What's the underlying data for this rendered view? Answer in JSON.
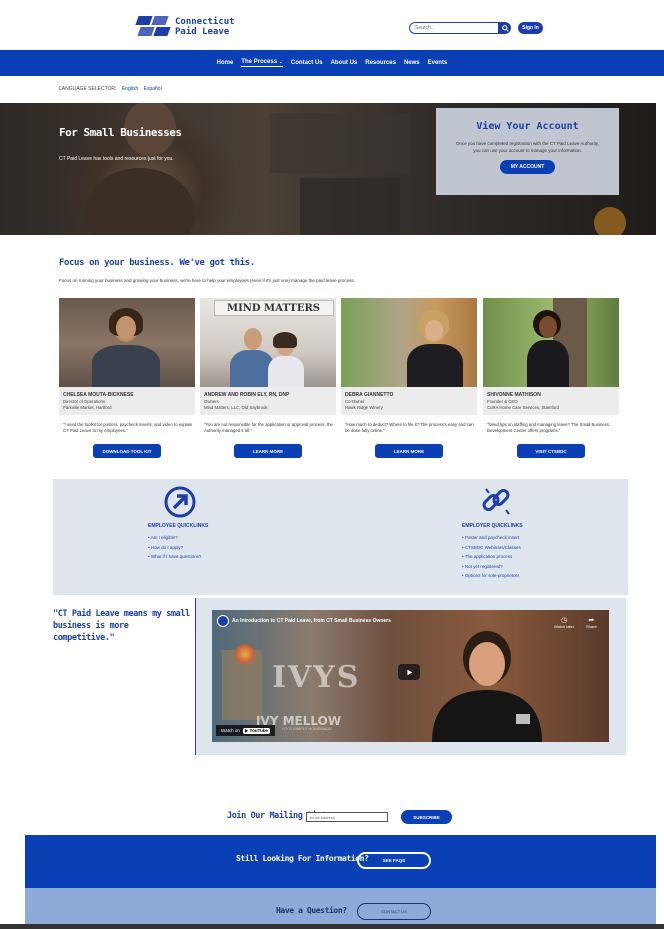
{
  "header": {
    "logo_line1": "Connecticut",
    "logo_line2": "Paid Leave",
    "search_placeholder": "Search...",
    "signin_label": "Sign In"
  },
  "nav": {
    "items": [
      "Home",
      "The Process",
      "Contact Us",
      "About Us",
      "Resources",
      "News",
      "Events"
    ],
    "active": "The Process"
  },
  "language": {
    "label": "LANGUAGE SELECTOR:",
    "english": "English",
    "spanish": "Español"
  },
  "hero": {
    "title": "For Small Businesses",
    "subtitle": "CT Paid Leave has tools and resources just for you.",
    "account_title": "View Your Account",
    "account_text": "Once you have completed registration with the CT Paid Leave Authority, you can use your account to manage your information.",
    "account_button": "MY ACCOUNT"
  },
  "focus": {
    "title": "Focus on your business. We've got this.",
    "text": "Focus on running your business and growing your business, we're here to help your employees (even if it's just one) manage the paid leave process."
  },
  "cards": [
    {
      "name": "CHELSEA MOUTA-BICKNESE",
      "role": "Director of Operations",
      "org": "Parkville Market, Hartford",
      "quote": "\"I used the toolkit for posters, paycheck inserts, and video to explain CT Paid Leave to my employees.\"",
      "button": "DOWNLOAD TOOL KIT"
    },
    {
      "name": "ANDREW AND ROBIN ELY, RN, DNP",
      "role": "Owners",
      "org": "Mind Matters, LLC, Old Saybrook",
      "quote": "\"You are not responsible for the application or approval process, the Authority managed it all.\"",
      "button": "LEARN MORE",
      "sign": "MIND MATTERS"
    },
    {
      "name": "DEBRA GIANNETTO",
      "role": "Co-Owner",
      "org": "Hawk Ridge Winery",
      "quote": "\"How much to deduct? Where to file it? The process's easy and can be done fully online.\"",
      "button": "LEARN MORE"
    },
    {
      "name": "SHIVONNE MATHISON",
      "role": "Founder & CEO",
      "org": "CuRA Home Care Services, Stamford",
      "quote": "\"Need tips on staffing and managing leave? The Small Business Development Center offers programs.\"",
      "button": "VISIT CTSBDC"
    }
  ],
  "quicklinks": {
    "employee_title": "EMPLOYEE QUICKLINKS",
    "employee_links": [
      "Am I eligible?",
      "How do I apply?",
      "What if I have questions?"
    ],
    "employer_title": "EMPLOYER QUICKLINKS",
    "employer_links": [
      "Poster and paycheck insert",
      "CTSBDC Webinars/Classes",
      "The application process",
      "Not yet registered?",
      "Options for sole-proprietors"
    ]
  },
  "testimonial": {
    "quote": "\"CT Paid Leave means my small business is more competitive.\""
  },
  "video": {
    "title": "An Introduction to CT Paid Leave, from CT Small Business Owners",
    "watch_later": "Watch later",
    "share": "Share",
    "watch_on": "Watch on",
    "youtube": "YouTube",
    "sign_text": "IVYS",
    "sign_text2": "IVY MELLOW",
    "sign_text3": "IVY'S SIMPLY HOMEMADE"
  },
  "mailing": {
    "label": "Join Our Mailing List",
    "placeholder": "email address",
    "button": "SUBSCRIBE"
  },
  "footer": {
    "info_text": "Still Looking For Information?",
    "info_button": "SEE FAQS",
    "question_text": "Have a Question?",
    "question_button": "CONTACT US"
  },
  "colors": {
    "brand_blue": "#0b3fb5",
    "light_panel": "#dfe5ec",
    "footer_light": "#8eaad8"
  }
}
